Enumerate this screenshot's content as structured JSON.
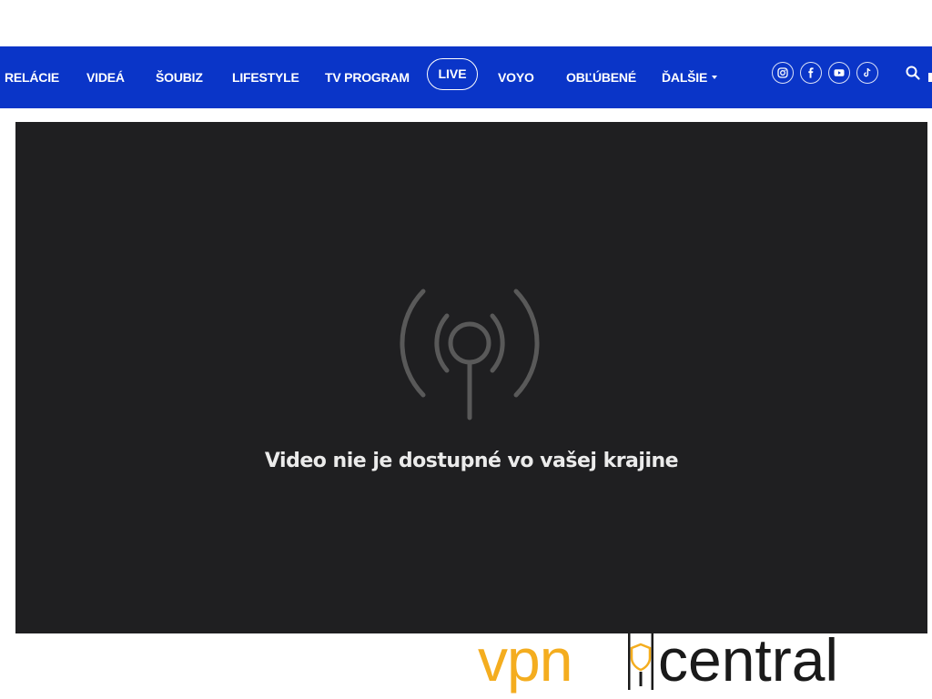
{
  "nav": {
    "items": [
      {
        "label": "RELÁCIE"
      },
      {
        "label": "VIDEÁ"
      },
      {
        "label": "ŠOUBIZ"
      },
      {
        "label": "LIFESTYLE"
      },
      {
        "label": "TV PROGRAM"
      },
      {
        "label": "LIVE",
        "active": true
      },
      {
        "label": "VOYO"
      },
      {
        "label": "OBĽÚBENÉ"
      },
      {
        "label": "ĎALŠIE"
      }
    ],
    "background_color": "#0a35c8",
    "social_icons": [
      "instagram-icon",
      "facebook-icon",
      "youtube-icon",
      "tiktok-icon"
    ],
    "search_icon": "search-icon"
  },
  "player": {
    "background_color": "#1f1f21",
    "icon": "broadcast-icon",
    "message": "Video nie je dostupné vo vašej krajine"
  },
  "watermark": {
    "part1": "vpn",
    "part2": "central",
    "accent_color": "#f4ad1f"
  }
}
